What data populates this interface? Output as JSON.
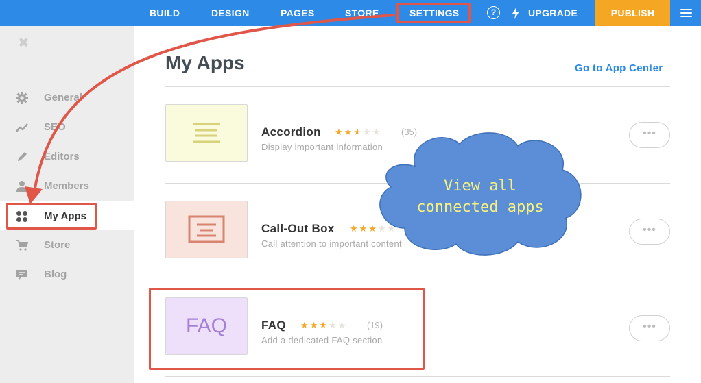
{
  "topbar": {
    "nav": [
      "BUILD",
      "DESIGN",
      "PAGES",
      "STORE",
      "SETTINGS"
    ],
    "help_icon": "?",
    "upgrade_label": "UPGRADE",
    "publish_label": "PUBLISH"
  },
  "sidebar": {
    "close_icon": "✖",
    "items": [
      {
        "label": "General",
        "icon": "gear-icon"
      },
      {
        "label": "SEO",
        "icon": "trend-icon"
      },
      {
        "label": "Editors",
        "icon": "pencil-icon"
      },
      {
        "label": "Members",
        "icon": "person-icon"
      },
      {
        "label": "My Apps",
        "icon": "grid-icon"
      },
      {
        "label": "Store",
        "icon": "cart-icon"
      },
      {
        "label": "Blog",
        "icon": "comment-icon"
      }
    ]
  },
  "main": {
    "title": "My Apps",
    "app_center_link": "Go to App Center",
    "apps": [
      {
        "name": "Accordion",
        "rating": 2.5,
        "count": "(35)",
        "description": "Display important information",
        "more": "•••"
      },
      {
        "name": "Call-Out Box",
        "rating": 3,
        "count": "",
        "description": "Call attention to important content",
        "more": "•••"
      },
      {
        "name": "FAQ",
        "rating": 3,
        "count": "(19)",
        "description": "Add a dedicated FAQ section",
        "more": "•••",
        "thumb_text": "FAQ"
      }
    ]
  },
  "annotation": {
    "callout_line1": "View all",
    "callout_line2": "connected apps"
  },
  "colors": {
    "topbar": "#2d8ae6",
    "publish": "#f5a623",
    "highlight": "#e0574a",
    "cloud": "#5b8ed6",
    "callout_text": "#f8f27a"
  }
}
